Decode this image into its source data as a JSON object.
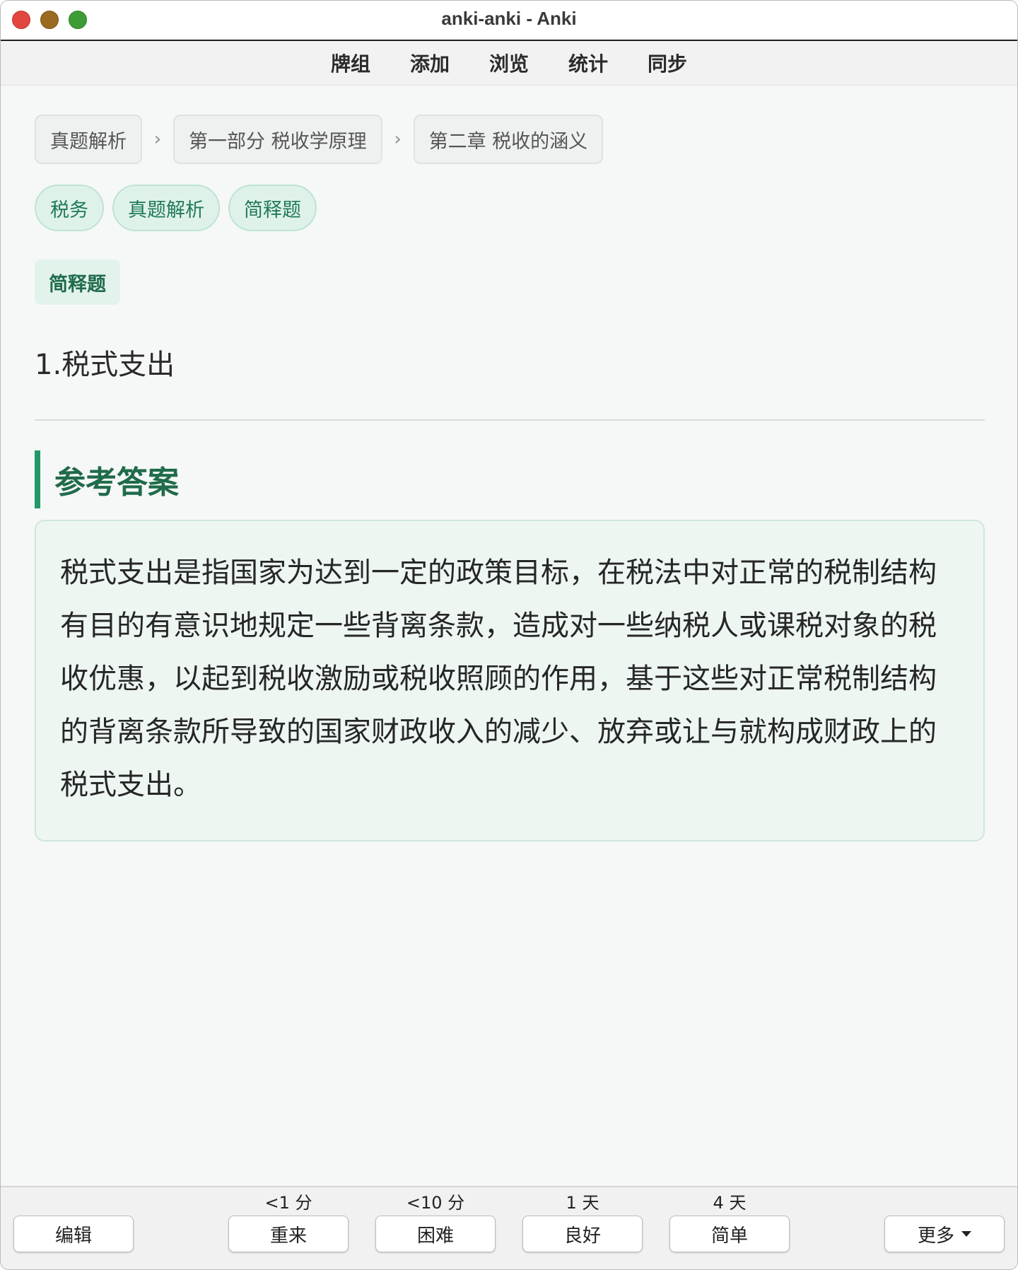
{
  "window": {
    "title": "anki-anki - Anki"
  },
  "menu": {
    "items": [
      "牌组",
      "添加",
      "浏览",
      "统计",
      "同步"
    ]
  },
  "breadcrumb": [
    "真题解析",
    "第一部分 税收学原理",
    "第二章 税收的涵义"
  ],
  "breadcrumb_separator": "›",
  "tags": [
    "税务",
    "真题解析",
    "简释题"
  ],
  "card": {
    "type_badge": "简释题",
    "question": "1.税式支出",
    "answer_heading": "参考答案",
    "answer_text": "税式支出是指国家为达到一定的政策目标，在税法中对正常的税制结构有目的有意识地规定一些背离条款，造成对一些纳税人或课税对象的税收优惠，以起到税收激励或税收照顾的作用，基于这些对正常税制结构的背离条款所导致的国家财政收入的减少、放弃或让与就构成财政上的税式支出。"
  },
  "bottom": {
    "edit_label": "编辑",
    "answers": [
      {
        "interval": "<1 分",
        "label": "重来"
      },
      {
        "interval": "<10 分",
        "label": "困难"
      },
      {
        "interval": "1 天",
        "label": "良好"
      },
      {
        "interval": "4 天",
        "label": "简单"
      }
    ],
    "more_label": "更多"
  },
  "colors": {
    "accent": "#1f9a66",
    "accent_text": "#1f6b4a",
    "tag_bg": "#dff2ea"
  }
}
